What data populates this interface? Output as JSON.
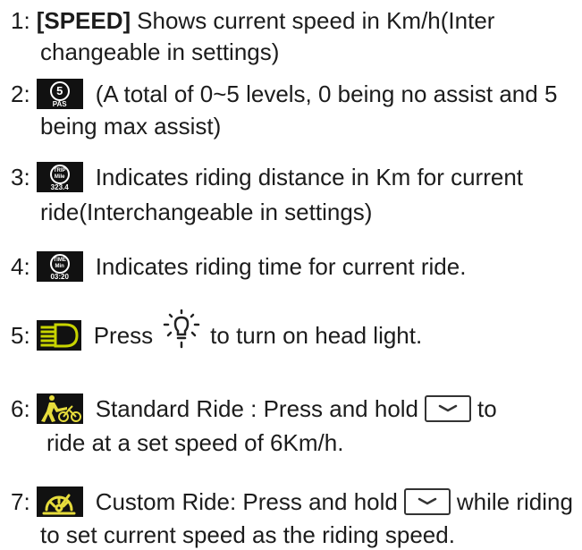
{
  "items": [
    {
      "num": "1:",
      "label": "[SPEED]",
      "line1": "Shows current speed in Km/h(Inter",
      "line2": "changeable in settings)"
    },
    {
      "num": "2:",
      "icon_text": "5",
      "icon_sub": "PAS",
      "line1": "(A total of 0~5 levels, 0 being no assist and 5",
      "line2": "being max assist)"
    },
    {
      "num": "3:",
      "icon_text_a": "TRIP",
      "icon_text_b": "Mile",
      "icon_sub": "323.4",
      "line1": "Indicates riding distance in Km for current",
      "line2": "ride(Interchangeable in settings)"
    },
    {
      "num": "4:",
      "icon_text_a": "TIME",
      "icon_text_b": "Min",
      "icon_sub": "03:20",
      "line1": "Indicates riding time for current ride."
    },
    {
      "num": "5:",
      "pre": "Press",
      "post": "to turn on head light."
    },
    {
      "num": "6:",
      "line1a": "Standard Ride : Press and hold",
      "line1b": "to",
      "line2": "ride at a set speed of 6Km/h."
    },
    {
      "num": "7:",
      "line1a": "Custom Ride: Press and hold",
      "line1b": "while riding",
      "line2": "to set current speed as the riding speed."
    }
  ],
  "colors": {
    "text": "#1c1c1c",
    "icon_bg": "#111111",
    "icon_green": "#c8d400",
    "icon_yellow": "#e6dc3c"
  }
}
